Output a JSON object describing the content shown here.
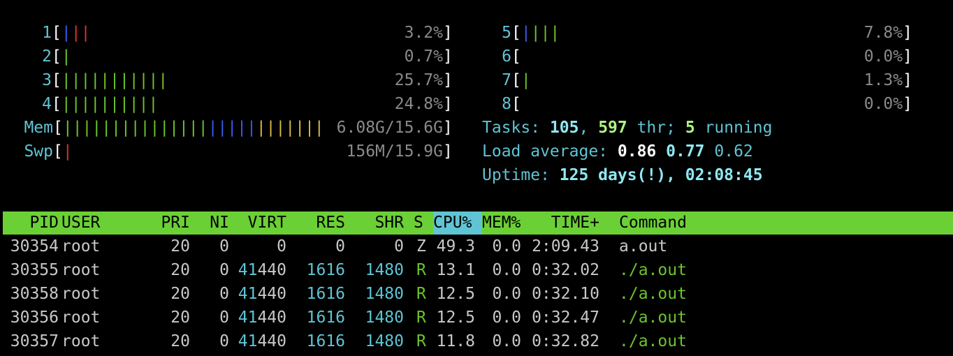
{
  "cpus_left": [
    {
      "label": "1",
      "bars": [
        {
          "text": "|",
          "color": "blue"
        },
        {
          "text": "||",
          "color": "red"
        }
      ],
      "value": "3.2%"
    },
    {
      "label": "2",
      "bars": [
        {
          "text": "|",
          "color": "green"
        }
      ],
      "value": "0.7%"
    },
    {
      "label": "3",
      "bars": [
        {
          "text": "|||||||||||",
          "color": "green"
        }
      ],
      "value": "25.7%"
    },
    {
      "label": "4",
      "bars": [
        {
          "text": "||||||||||",
          "color": "green"
        }
      ],
      "value": "24.8%"
    }
  ],
  "cpus_right": [
    {
      "label": "5",
      "bars": [
        {
          "text": "|",
          "color": "blue"
        },
        {
          "text": "|||",
          "color": "green"
        }
      ],
      "value": "7.8%"
    },
    {
      "label": "6",
      "bars": [],
      "value": "0.0%"
    },
    {
      "label": "7",
      "bars": [
        {
          "text": "|",
          "color": "green"
        }
      ],
      "value": "1.3%"
    },
    {
      "label": "8",
      "bars": [],
      "value": "0.0%"
    }
  ],
  "memory": {
    "label": "Mem",
    "bars": [
      {
        "text": "|||||||||||||||",
        "color": "green"
      },
      {
        "text": "|||||",
        "color": "blue"
      },
      {
        "text": "|||||||",
        "color": "yellow"
      }
    ],
    "value": "6.08G/15.6G"
  },
  "swap": {
    "label": "Swp",
    "bars": [
      {
        "text": "|",
        "color": "red"
      }
    ],
    "value": "156M/15.9G"
  },
  "tasks": {
    "label": "Tasks: ",
    "count": "105",
    "sep1": ", ",
    "threads": "597",
    "thr_label": " thr; ",
    "running": "5",
    "running_label": " running"
  },
  "load": {
    "label": "Load average: ",
    "one": "0.86",
    "five": "0.77",
    "fifteen": "0.62"
  },
  "uptime": {
    "label": "Uptime: ",
    "value": "125 days(!), 02:08:45"
  },
  "columns": {
    "pid": "PID",
    "user": "USER",
    "pri": "PRI",
    "ni": "NI",
    "virt": "VIRT",
    "res": "RES",
    "shr": "SHR",
    "s": "S",
    "cpu": "CPU%",
    "mem": "MEM%",
    "time": "TIME+",
    "command": "Command"
  },
  "processes": [
    {
      "pid": "30354",
      "user": "root",
      "pri": "20",
      "ni": "0",
      "virt": "0",
      "res": "0",
      "shr": "0",
      "s": "Z",
      "cpu": "49.3",
      "mem": "0.0",
      "time": "2:09.43",
      "command": "a.out",
      "running": false
    },
    {
      "pid": "30355",
      "user": "root",
      "pri": "20",
      "ni": "0",
      "virt": "41440",
      "res": "1616",
      "shr": "1480",
      "s": "R",
      "cpu": "13.1",
      "mem": "0.0",
      "time": "0:32.02",
      "command": "./a.out",
      "running": true
    },
    {
      "pid": "30358",
      "user": "root",
      "pri": "20",
      "ni": "0",
      "virt": "41440",
      "res": "1616",
      "shr": "1480",
      "s": "R",
      "cpu": "12.5",
      "mem": "0.0",
      "time": "0:32.10",
      "command": "./a.out",
      "running": true
    },
    {
      "pid": "30356",
      "user": "root",
      "pri": "20",
      "ni": "0",
      "virt": "41440",
      "res": "1616",
      "shr": "1480",
      "s": "R",
      "cpu": "12.5",
      "mem": "0.0",
      "time": "0:32.47",
      "command": "./a.out",
      "running": true
    },
    {
      "pid": "30357",
      "user": "root",
      "pri": "20",
      "ni": "0",
      "virt": "41440",
      "res": "1616",
      "shr": "1480",
      "s": "R",
      "cpu": "11.8",
      "mem": "0.0",
      "time": "0:32.82",
      "command": "./a.out",
      "running": true
    }
  ],
  "colors": {
    "header_bg": "#6bd035",
    "sorted_col_bg": "#5fc4d4",
    "cyan": "#5fc4d4",
    "green": "#6bc42c"
  }
}
